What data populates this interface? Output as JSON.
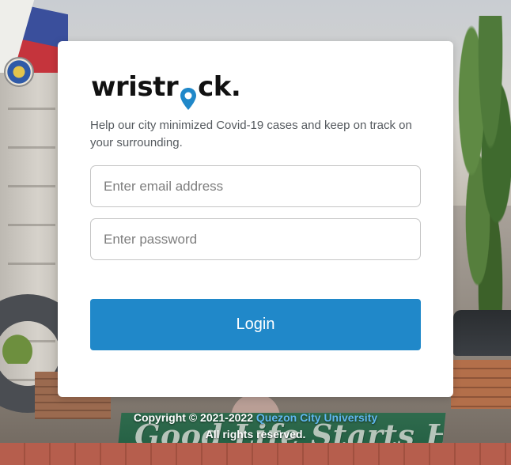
{
  "app": {
    "logo_text_part1": "wristr",
    "logo_text_part2": "ck.",
    "logo_pin_icon": "map-pin-icon",
    "tagline": "Help our city minimized Covid-19 cases and keep on track on your surrounding."
  },
  "form": {
    "email_placeholder": "Enter email address",
    "password_placeholder": "Enter password",
    "login_label": "Login"
  },
  "footer": {
    "copyright_prefix": "Copyright © 2021-2022",
    "university": "Quezon City University",
    "rights": "All rights reserved."
  },
  "background": {
    "banner_text": "Good Life Starts Here!"
  },
  "colors": {
    "accent": "#2088c9",
    "pin": "#2088c9",
    "footer_link": "#5fb8f0"
  }
}
